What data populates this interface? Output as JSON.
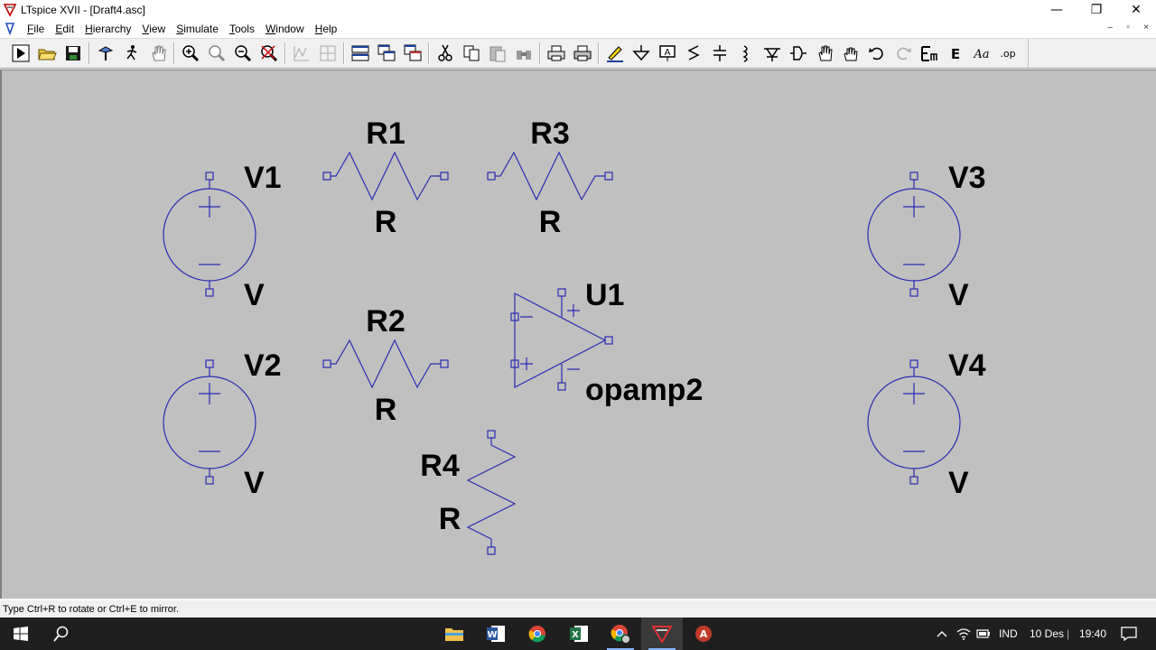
{
  "window": {
    "title": "LTspice XVII - [Draft4.asc]",
    "minimize_glyph": "—",
    "restore_glyph": "❐",
    "close_glyph": "✕"
  },
  "menu": {
    "items": [
      "File",
      "Edit",
      "Hierarchy",
      "View",
      "Simulate",
      "Tools",
      "Window",
      "Help"
    ],
    "mdi_minimize": "–",
    "mdi_restore": "▫",
    "mdi_close": "×"
  },
  "toolbar": {
    "icons": [
      "run-icon",
      "open-folder-icon",
      "save-icon",
      "control-panel-icon",
      "halt-icon",
      "pan-hand-icon",
      "zoom-in-icon",
      "zoom-pan-icon",
      "zoom-out-icon",
      "zoom-fit-icon",
      "autorange-icon",
      "grid-icon",
      "tile-horizontal-icon",
      "cascade-icon",
      "tile-vertical-icon",
      "cut-icon",
      "copy-icon",
      "paste-icon",
      "find-icon",
      "print-setup-icon",
      "print-icon",
      "draw-wire-icon",
      "ground-icon",
      "label-net-icon",
      "resistor-icon",
      "capacitor-icon",
      "inductor-icon",
      "diode-icon",
      "component-icon",
      "move-icon",
      "drag-icon",
      "undo-icon",
      "redo-icon",
      "rotate-icon",
      "mirror-icon",
      "text-icon",
      "spice-directive-icon"
    ],
    "text_icons": {
      "mirror": "E",
      "text": "Aa",
      "op": ".op"
    }
  },
  "schematic": {
    "colors": {
      "wire": "#2b2bb4",
      "pin": "#2b2bb4",
      "label": "#000000",
      "background": "#c0c0c0"
    },
    "components": {
      "R1": {
        "name": "R1",
        "value": "R"
      },
      "R2": {
        "name": "R2",
        "value": "R"
      },
      "R3": {
        "name": "R3",
        "value": "R"
      },
      "R4": {
        "name": "R4",
        "value": "R"
      },
      "V1": {
        "name": "V1",
        "value": "V"
      },
      "V2": {
        "name": "V2",
        "value": "V"
      },
      "V3": {
        "name": "V3",
        "value": "V"
      },
      "V4": {
        "name": "V4",
        "value": "V"
      },
      "U1": {
        "name": "U1",
        "value": "opamp2"
      }
    }
  },
  "status": {
    "text": "Type Ctrl+R to rotate or Ctrl+E to mirror."
  },
  "taskbar": {
    "apps": [
      "file-explorer-icon",
      "word-icon",
      "chrome-icon",
      "excel-icon",
      "chrome-profile-icon",
      "ltspice-icon",
      "other-app-icon"
    ],
    "language": "IND",
    "date": "10 Des",
    "time": "19:40"
  }
}
